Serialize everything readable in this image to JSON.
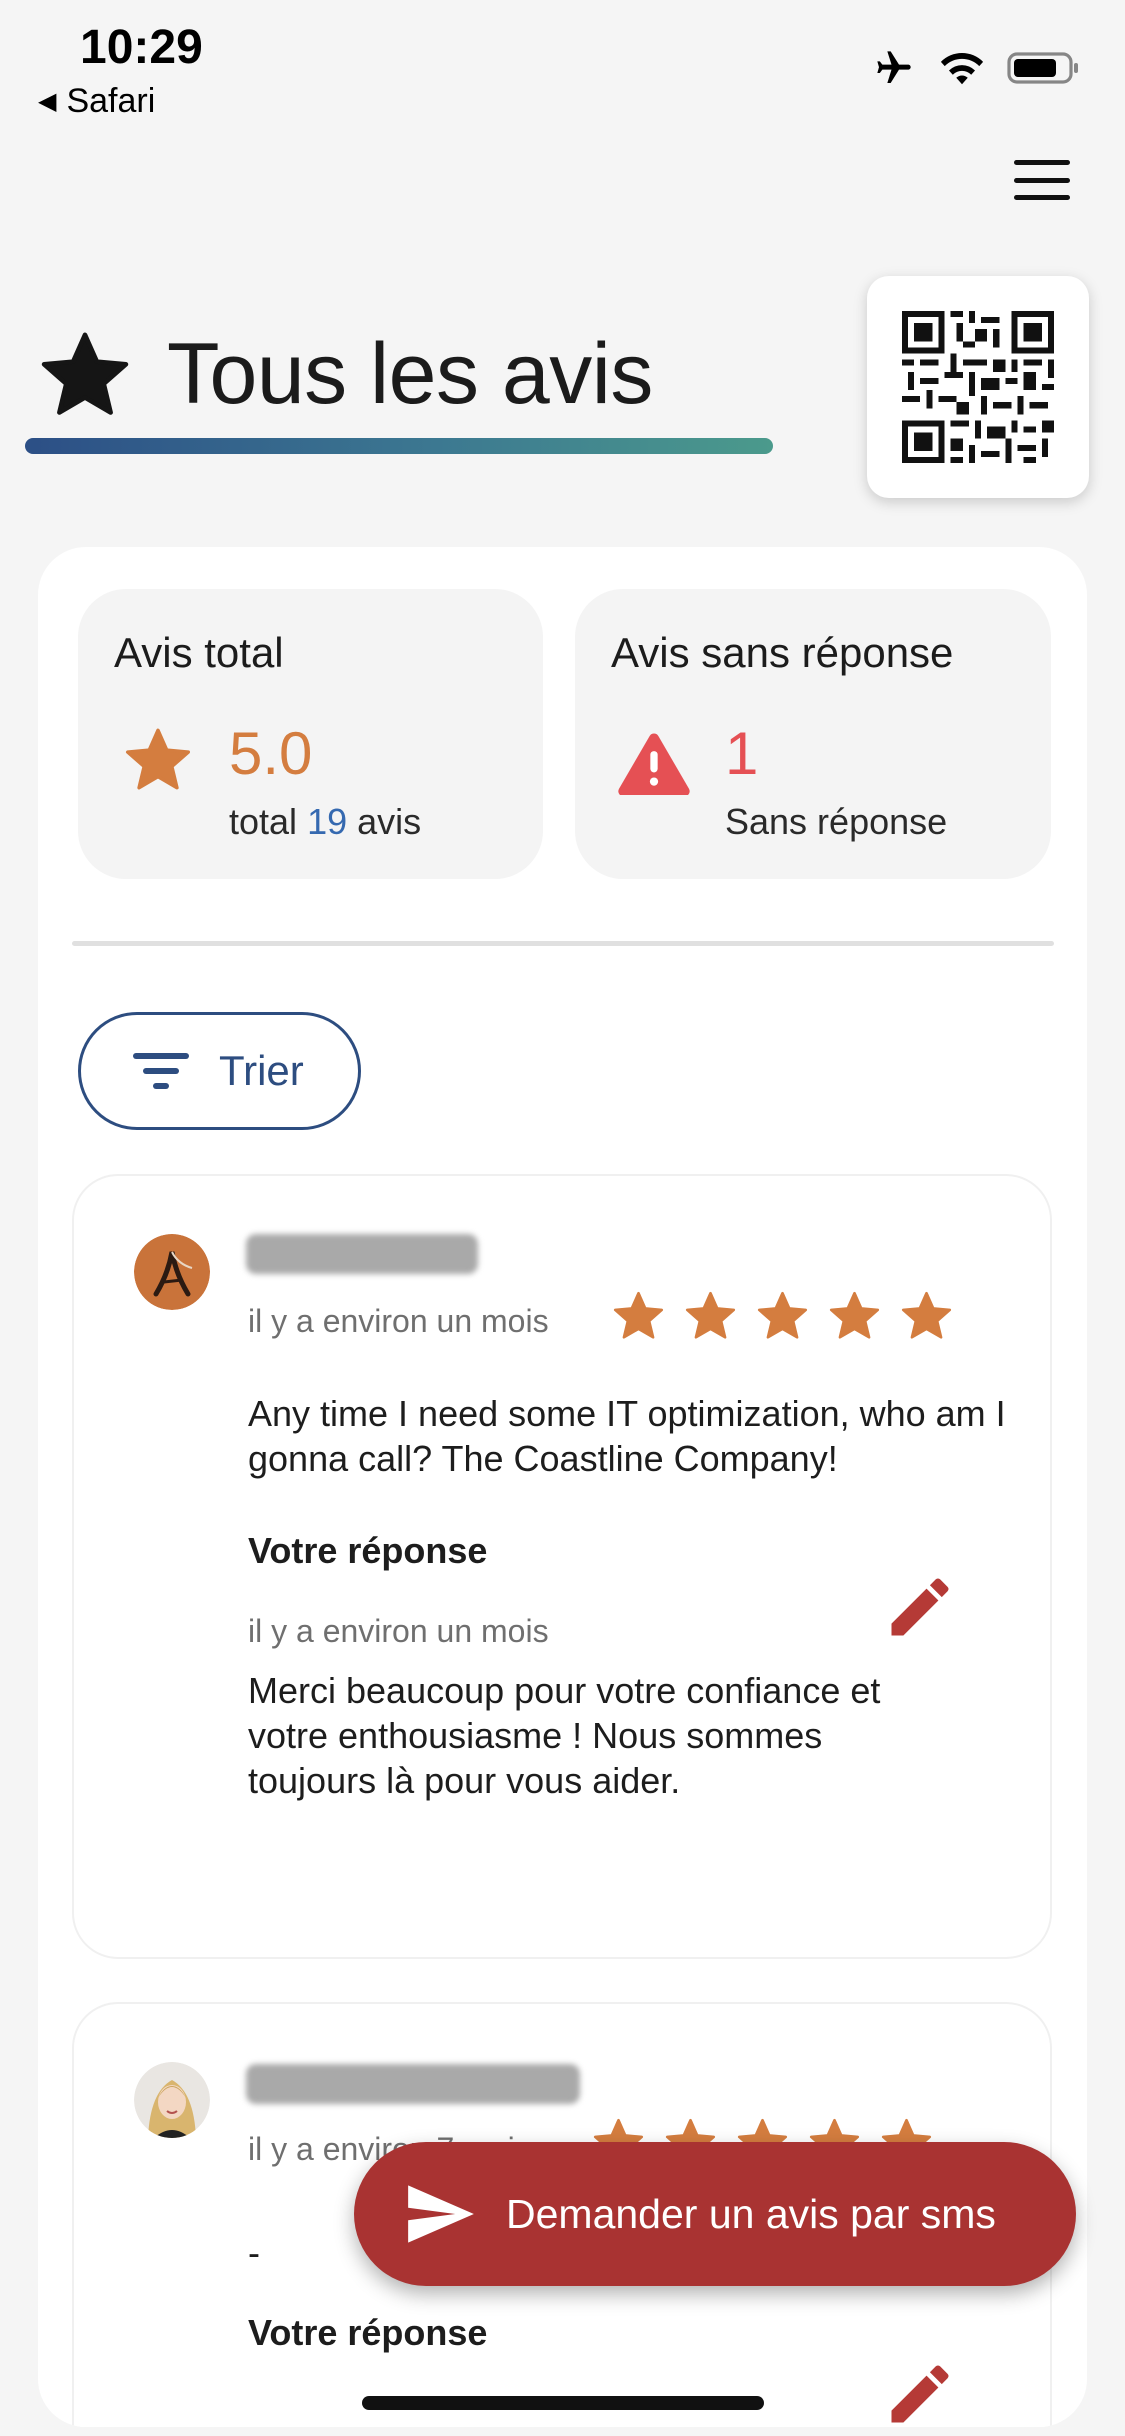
{
  "status_bar": {
    "time": "10:29",
    "back_app": "Safari"
  },
  "header": {
    "menu_icon": "hamburger-icon",
    "title": "Tous les avis",
    "title_icon": "star-icon",
    "qr_icon": "qr-code-icon",
    "gradient_colors": [
      "#2c4f86",
      "#4b9a8c"
    ]
  },
  "stats": {
    "total": {
      "title": "Avis total",
      "value": "5.0",
      "sub_prefix": "total",
      "count": "19",
      "sub_suffix": "avis",
      "icon": "star-icon",
      "color": "#d47d3f"
    },
    "unanswered": {
      "title": "Avis sans réponse",
      "value": "1",
      "sub": "Sans réponse",
      "icon": "warning-icon",
      "color": "#e55054"
    }
  },
  "sort": {
    "label": "Trier",
    "icon": "filter-icon"
  },
  "reviews": [
    {
      "name": "█████████ ███",
      "date": "il y a environ un mois",
      "rating": 5,
      "text": "Any time I need some IT optimization, who am I gonna call? The Coastline Company!",
      "response_title": "Votre réponse",
      "response_date": "il y a environ un mois",
      "response_text": "Merci beaucoup pour votre confiance et votre enthousiasme ! Nous sommes toujours là pour vous aider."
    },
    {
      "name": "█████████████ ██████",
      "date": "il y a environ 7 mois",
      "rating": 5,
      "text": "-",
      "response_title": "Votre réponse"
    }
  ],
  "fab": {
    "label": "Demander un avis par sms",
    "icon": "send-icon",
    "color": "#a93332"
  },
  "colors": {
    "star": "#d47d3f",
    "accent_blue": "#2d4d80",
    "edit": "#b53a36"
  }
}
